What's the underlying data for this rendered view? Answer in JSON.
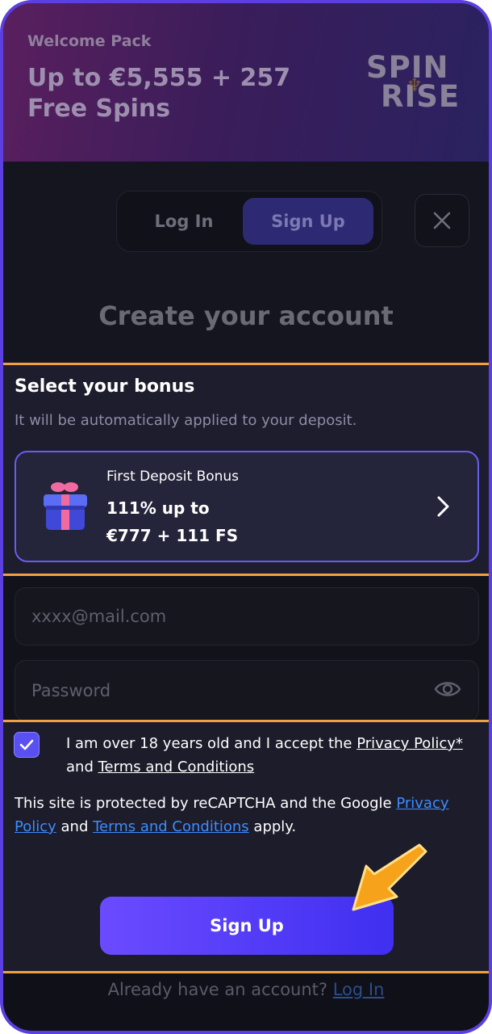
{
  "banner": {
    "label": "Welcome Pack",
    "title": "Up to €5,555 + 257 Free Spins",
    "logo_line1": "SPIN",
    "logo_line2": "RISE"
  },
  "auth_tabs": {
    "login": "Log In",
    "signup": "Sign Up",
    "active": "signup"
  },
  "close_icon": "close-icon",
  "page_title": "Create your account",
  "bonus": {
    "heading": "Select your bonus",
    "subheading": "It will be automatically applied to your deposit.",
    "card": {
      "type": "First Deposit Bonus",
      "offer_line1": "111% up to",
      "offer_line2": "€777 + 111 FS"
    }
  },
  "form": {
    "email_placeholder": "xxxx@mail.com",
    "password_placeholder": "Password"
  },
  "consent": {
    "checked": true,
    "agree_prefix": "I am over 18 years old and I accept the ",
    "privacy_policy_link": "Privacy Policy*",
    "agree_and": " and ",
    "terms_link": "Terms and Conditions",
    "recaptcha_prefix": "This site is protected by reCAPTCHA and the Google ",
    "google_privacy_link": "Privacy Policy",
    "recaptcha_and": " and ",
    "google_terms_link": "Terms and Conditions",
    "recaptcha_suffix": " apply."
  },
  "signup_button": "Sign Up",
  "footer": {
    "prompt": "Already have an account? ",
    "login_link": "Log In"
  },
  "colors": {
    "accent": "#5a4ff0",
    "highlight_line": "#f0a040",
    "link_blue": "#3d8cff",
    "pointer_arrow": "#f7a21b"
  }
}
